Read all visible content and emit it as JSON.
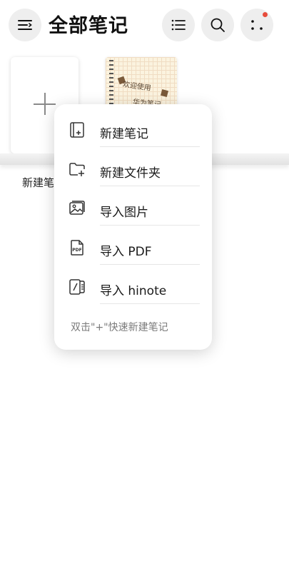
{
  "header": {
    "title": "全部笔记",
    "menu_icon": "menu-icon",
    "list_icon": "list-view-icon",
    "search_icon": "search-icon",
    "more_icon": "more-dots-icon",
    "badge_color": "#e74c3c"
  },
  "gallery": {
    "new_card_label": "新建笔记",
    "sample_cover_text_1": "欢迎使用",
    "sample_cover_text_2": "华为笔记"
  },
  "popup_menu": {
    "items": [
      {
        "label": "新建笔记",
        "icon": "new-note-icon"
      },
      {
        "label": "新建文件夹",
        "icon": "new-folder-icon"
      },
      {
        "label": "导入图片",
        "icon": "image-icon"
      },
      {
        "label": "导入 PDF",
        "icon": "pdf-icon"
      },
      {
        "label": "导入 hinote",
        "icon": "hinote-icon"
      }
    ],
    "hint": "双击\"+\"快速新建笔记"
  }
}
